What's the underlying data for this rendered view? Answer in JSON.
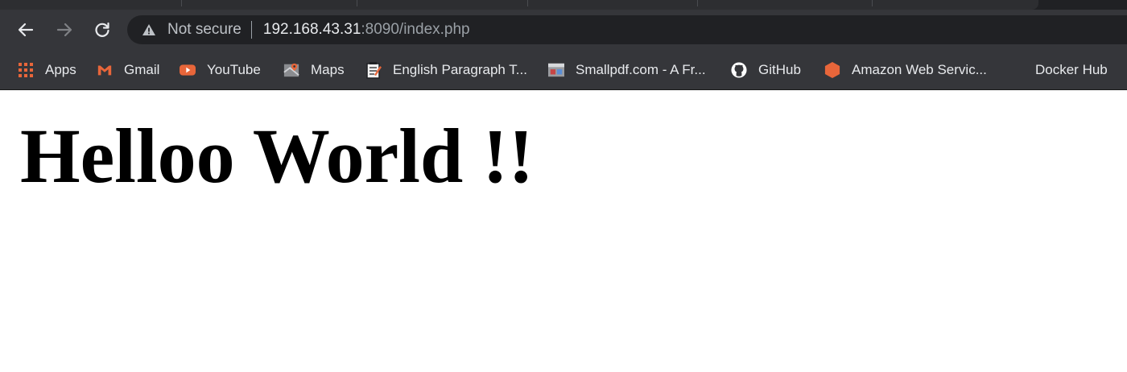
{
  "browser": {
    "security_label": "Not secure",
    "url_host": "192.168.43.31",
    "url_rest": ":8090/index.php",
    "icons": {
      "back": "back-arrow-icon",
      "forward": "forward-arrow-icon",
      "reload": "reload-icon",
      "security": "warning-triangle-icon"
    }
  },
  "bookmarks": [
    {
      "label": "Apps",
      "icon": "apps-grid-icon"
    },
    {
      "label": "Gmail",
      "icon": "gmail-icon"
    },
    {
      "label": "YouTube",
      "icon": "youtube-icon"
    },
    {
      "label": "Maps",
      "icon": "maps-icon"
    },
    {
      "label": "English Paragraph T...",
      "icon": "notepad-icon"
    },
    {
      "label": "Smallpdf.com - A Fr...",
      "icon": "smallpdf-icon"
    },
    {
      "label": "GitHub",
      "icon": "github-icon"
    },
    {
      "label": "Amazon Web Servic...",
      "icon": "aws-hexagon-icon"
    },
    {
      "label": "Docker Hub",
      "icon": ""
    }
  ],
  "page": {
    "heading": "Helloo World !!"
  },
  "colors": {
    "chrome_dark": "#202124",
    "toolbar": "#35363a",
    "text_light": "#e8eaed",
    "url_dim": "#9aa0a6"
  }
}
